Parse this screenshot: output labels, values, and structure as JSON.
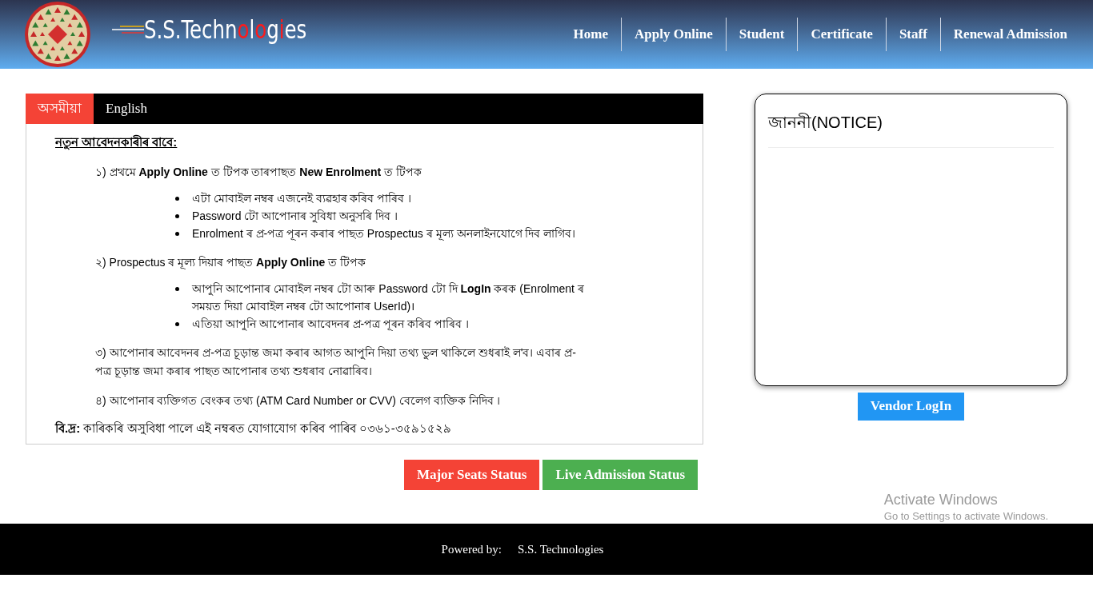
{
  "header": {
    "logo_text": [
      {
        "text": "S.S.Techn",
        "accent": false
      },
      {
        "text": "o",
        "accent": true
      },
      {
        "text": "l",
        "accent": false
      },
      {
        "text": "o",
        "accent": true
      },
      {
        "text": "g",
        "accent": false
      },
      {
        "text": "i",
        "accent": true
      },
      {
        "text": "es",
        "accent": false
      }
    ],
    "nav": [
      "Home",
      "Apply Online",
      "Student",
      "Certificate",
      "Staff",
      "Renewal Admission"
    ]
  },
  "tabs": [
    {
      "label": "অসমীয়া",
      "selected": true
    },
    {
      "label": "English",
      "selected": false
    }
  ],
  "instructions": {
    "heading": "নতুন আবেদনকাৰীৰ বাবে:",
    "blocks": [
      {
        "kind": "step",
        "text": "১) প্ৰথমে **Apply Online** ত টিপক তাৰপাছত **New Enrolment** ত টিপক"
      },
      {
        "kind": "bullets",
        "items": [
          "এটা মোবাইল নম্বৰ এজনেই ব্যৱহাৰ কৰিব পাৰিব ।",
          "Password টো আপোনাৰ সুবিধা অনুসৰি দিব ।",
          "Enrolment ৰ প্ৰ-পত্ৰ পূৰন কৰাৰ পাছত Prospectus ৰ মূল্য অনলাইনযোগে দিব লাগিব।"
        ]
      },
      {
        "kind": "step",
        "text": "২) Prospectus ৰ মূল্য দিয়াৰ পাছত **Apply Online** ত টিপক"
      },
      {
        "kind": "bullets",
        "items": [
          "আপুনি আপোনাৰ মোবাইল নম্বৰ টো আৰু Password টো দি **LogIn** কৰক (Enrolment ৰ সময়ত দিয়া মোবাইল নম্বৰ টো আপোনাৰ UserId)।",
          "এতিয়া আপুনি আপোনাৰ আবেদনৰ প্ৰ-পত্ৰ পূৰন কৰিব পাৰিব ।"
        ]
      },
      {
        "kind": "step",
        "text": "৩) আপোনাৰ আবেদনৰ প্ৰ-পত্ৰ চূড়ান্ত জমা কৰাৰ আগত আপুনি দিয়া তথ্য ভুল থাকিলে শুধৰাই ল'ব। এবাৰ প্ৰ-পত্ৰ চূড়ান্ত জমা কৰাৰ পাছত আপোনাৰ তথ্য শুধৰাব নোৱাৰিব।"
      },
      {
        "kind": "step",
        "text": "৪) আপোনাৰ ব্যক্তিগত বেংকৰ তথ্য (ATM Card Number or CVV) বেলেগ ব্যক্তিক নিদিব ।"
      },
      {
        "kind": "note",
        "text": "**বি.দ্ৰ:** কাৰিকৰি অসুবিধা পালে এই নম্বৰত যোগাযোগ কৰিব পাৰিব ০৩৬১-৩৫৯১৫২৯"
      }
    ]
  },
  "status_buttons": [
    {
      "label": "Major Seats Status",
      "color": "#f44336"
    },
    {
      "label": "Live Admission Status",
      "color": "#4caf50"
    }
  ],
  "notice": {
    "title": "জাননী(NOTICE)"
  },
  "vendor_button": "Vendor LogIn",
  "os_overlay": {
    "title": "Activate Windows",
    "subtitle": "Go to Settings to activate Windows."
  },
  "footer": {
    "label": "Powered by:",
    "company": "S.S. Technologies"
  }
}
